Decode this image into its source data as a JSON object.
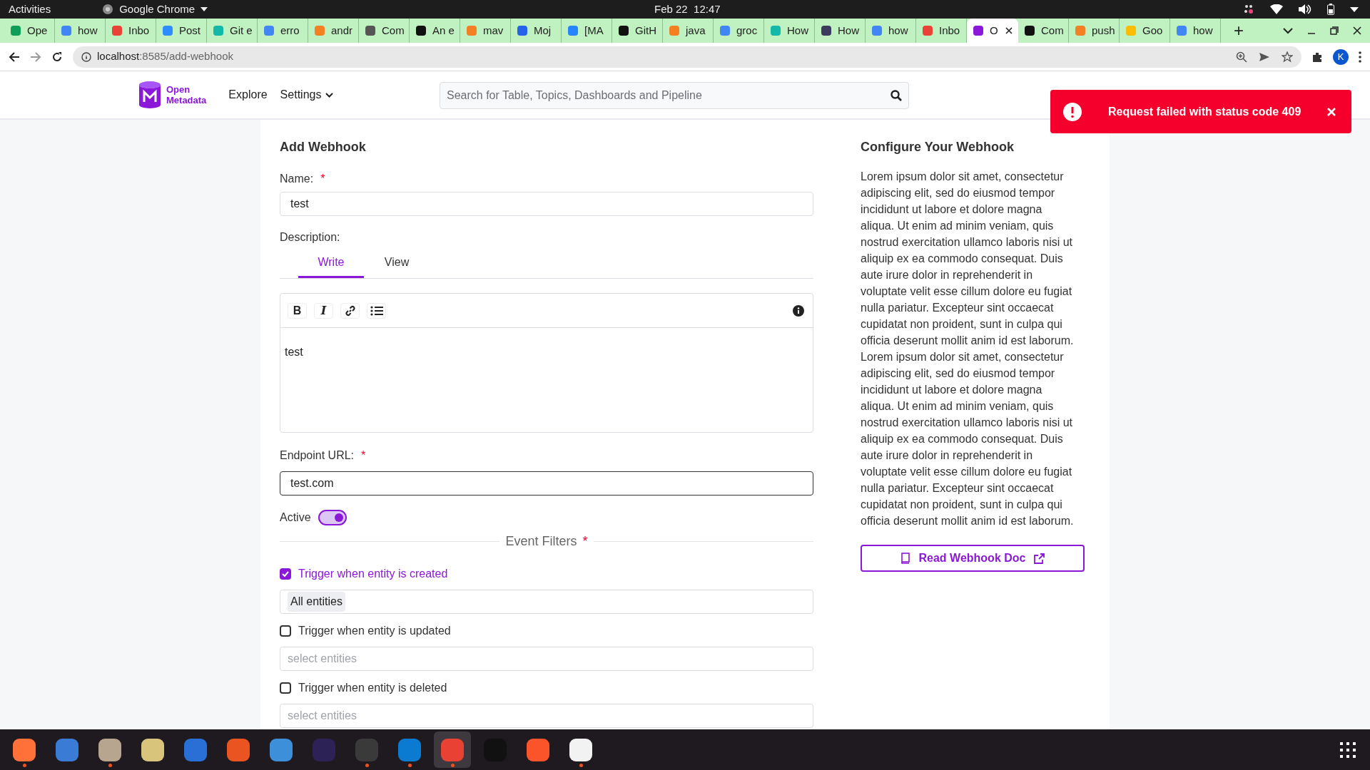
{
  "system_bar": {
    "activities": "Activities",
    "app": "Google Chrome",
    "clock": "Feb 22  12:47"
  },
  "browser": {
    "tabs": [
      {
        "label": "Ope",
        "color": "#0f9d58",
        "selected": false
      },
      {
        "label": "how",
        "color": "#4285f4",
        "selected": false
      },
      {
        "label": "Inbo",
        "color": "#ea4335",
        "selected": false
      },
      {
        "label": "Post",
        "color": "#2d8cff",
        "selected": false
      },
      {
        "label": "Git e",
        "color": "#14b8a6",
        "selected": false
      },
      {
        "label": "erro",
        "color": "#4285f4",
        "selected": false
      },
      {
        "label": "andr",
        "color": "#f48024",
        "selected": false
      },
      {
        "label": "Com",
        "color": "#555555",
        "selected": false
      },
      {
        "label": "An e",
        "color": "#111111",
        "selected": false
      },
      {
        "label": "mav",
        "color": "#f48024",
        "selected": false
      },
      {
        "label": "Moj",
        "color": "#2563eb",
        "selected": false
      },
      {
        "label": "[MA",
        "color": "#2684ff",
        "selected": false
      },
      {
        "label": "GitH",
        "color": "#111111",
        "selected": false
      },
      {
        "label": "java",
        "color": "#f48024",
        "selected": false
      },
      {
        "label": "groc",
        "color": "#4285f4",
        "selected": false
      },
      {
        "label": "How",
        "color": "#14b8a6",
        "selected": false
      },
      {
        "label": "How",
        "color": "#3b3b5c",
        "selected": false
      },
      {
        "label": "how",
        "color": "#4285f4",
        "selected": false
      },
      {
        "label": "Inbo",
        "color": "#ea4335",
        "selected": false
      },
      {
        "label": "O",
        "color": "#8b17d9",
        "selected": true
      },
      {
        "label": "Com",
        "color": "#111111",
        "selected": false
      },
      {
        "label": "push",
        "color": "#f48024",
        "selected": false
      },
      {
        "label": "Goo",
        "color": "#fbbc04",
        "selected": false
      },
      {
        "label": "how",
        "color": "#4285f4",
        "selected": false
      }
    ],
    "new_tab": "+",
    "url": {
      "host": "localhost",
      "path": ":8585/add-webhook"
    },
    "profile": "K"
  },
  "app": {
    "logo": {
      "line1": "Open",
      "line2": "Metadata"
    },
    "nav": [
      {
        "label": "Explore",
        "kind": "link"
      },
      {
        "label": "Settings",
        "kind": "dropdown"
      }
    ],
    "search": {
      "placeholder": "Search for Table, Topics, Dashboards and Pipeline"
    }
  },
  "toast": {
    "message": "Request failed with status code 409"
  },
  "form": {
    "title": "Add Webhook",
    "name": {
      "label": "Name:",
      "required_mark": "*",
      "value": "test"
    },
    "description": {
      "label": "Description:",
      "tabs": [
        {
          "label": "Write",
          "selected": true
        },
        {
          "label": "View",
          "selected": false
        }
      ],
      "toolbar": [
        {
          "kind": "bold",
          "glyph": "B"
        },
        {
          "kind": "italic",
          "glyph": "I"
        },
        {
          "kind": "link"
        },
        {
          "kind": "list"
        }
      ],
      "value": "test"
    },
    "endpoint": {
      "label": "Endpoint URL:",
      "required_mark": "*",
      "value": "test.com",
      "focused": true
    },
    "active": {
      "label": "Active",
      "on": true
    },
    "event_filters": {
      "title": "Event Filters",
      "required_mark": "*",
      "triggers": [
        {
          "label": "Trigger when entity is created",
          "checked": true,
          "tags": [
            "All entities"
          ]
        },
        {
          "label": "Trigger when entity is updated",
          "checked": false,
          "placeholder": "select entities"
        },
        {
          "label": "Trigger when entity is deleted",
          "checked": false,
          "placeholder": "select entities"
        }
      ]
    }
  },
  "help": {
    "title": "Configure Your Webhook",
    "text": "Lorem ipsum dolor sit amet, consectetur adipiscing elit, sed do eiusmod tempor incididunt ut labore et dolore magna aliqua. Ut enim ad minim veniam, quis nostrud exercitation ullamco laboris nisi ut aliquip ex ea commodo consequat. Duis aute irure dolor in reprehenderit in voluptate velit esse cillum dolore eu fugiat nulla pariatur. Excepteur sint occaecat cupidatat non proident, sunt in culpa qui officia deserunt mollit anim id est laborum. Lorem ipsum dolor sit amet, consectetur adipiscing elit, sed do eiusmod tempor incididunt ut labore et dolore magna aliqua. Ut enim ad minim veniam, quis nostrud exercitation ullamco laboris nisi ut aliquip ex ea commodo consequat. Duis aute irure dolor in reprehenderit in voluptate velit esse cillum dolore eu fugiat nulla pariatur. Excepteur sint occaecat cupidatat non proident, sunt in culpa qui officia deserunt mollit anim id est laborum.",
    "button": "Read Webhook Doc"
  },
  "dock": [
    {
      "color": "#ff7139",
      "running": true,
      "selected": false
    },
    {
      "color": "#3a7bd5",
      "running": false,
      "selected": false
    },
    {
      "color": "#b8a58f",
      "running": true,
      "selected": false
    },
    {
      "color": "#d8c47a",
      "running": false,
      "selected": false
    },
    {
      "color": "#2a6fd6",
      "running": false,
      "selected": false
    },
    {
      "color": "#e95420",
      "running": false,
      "selected": false
    },
    {
      "color": "#3d8fd9",
      "running": false,
      "selected": false
    },
    {
      "color": "#2c2255",
      "running": false,
      "selected": false
    },
    {
      "color": "#3a3a3a",
      "running": true,
      "selected": false
    },
    {
      "color": "#0a7bd0",
      "running": true,
      "selected": false
    },
    {
      "color": "#e94235",
      "running": true,
      "selected": true
    },
    {
      "color": "#111111",
      "running": false,
      "selected": false
    },
    {
      "color": "#fb542b",
      "running": false,
      "selected": false
    },
    {
      "color": "#f2f2f2",
      "running": true,
      "selected": false
    }
  ]
}
